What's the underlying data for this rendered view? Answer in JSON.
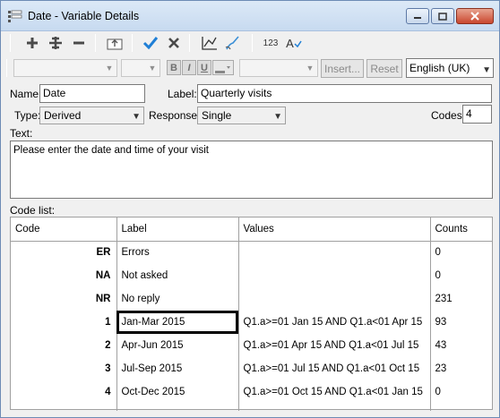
{
  "window": {
    "title": "Date - Variable Details"
  },
  "toolbar": {
    "icons": [
      "plus-icon",
      "plus-many-icon",
      "minus-icon",
      "tab-up-icon",
      "check-icon",
      "cross-icon",
      "chart-icon",
      "brush-icon",
      "numbers-icon",
      "spell-check-icon"
    ],
    "numbers_glyph": "123",
    "spell_glyph": "A"
  },
  "format_bar": {
    "bold": "B",
    "italic": "I",
    "underline": "U",
    "insert_label": "Insert...",
    "reset_label": "Reset",
    "language": "English (UK)"
  },
  "form": {
    "name_label": "Name:",
    "name_value": "Date",
    "label_label": "Label:",
    "label_value": "Quarterly visits",
    "type_label": "Type:",
    "type_value": "Derived",
    "response_label": "Response:",
    "response_value": "Single",
    "codes_label": "Codes:",
    "codes_value": "4",
    "text_label": "Text:",
    "text_value": "Please enter the date and time of your visit",
    "code_list_label": "Code list:"
  },
  "code_list": {
    "columns": [
      "Code",
      "Label",
      "Values",
      "Counts"
    ],
    "rows": [
      {
        "code": "ER",
        "label": "Errors",
        "values": "",
        "counts": "0"
      },
      {
        "code": "NA",
        "label": "Not asked",
        "values": "",
        "counts": "0"
      },
      {
        "code": "NR",
        "label": "No reply",
        "values": "",
        "counts": "231"
      },
      {
        "code": "1",
        "label": "Jan-Mar 2015",
        "values": "Q1.a>=01 Jan 15 AND Q1.a<01 Apr 15",
        "counts": "93"
      },
      {
        "code": "2",
        "label": "Apr-Jun 2015",
        "values": "Q1.a>=01 Apr 15 AND Q1.a<01 Jul 15",
        "counts": "43"
      },
      {
        "code": "3",
        "label": "Jul-Sep 2015",
        "values": "Q1.a>=01 Jul 15 AND Q1.a<01 Oct 15",
        "counts": "23"
      },
      {
        "code": "4",
        "label": "Oct-Dec 2015",
        "values": "Q1.a>=01 Oct 15 AND Q1.a<01 Jan 15",
        "counts": "0"
      }
    ],
    "selected_row": 3
  }
}
